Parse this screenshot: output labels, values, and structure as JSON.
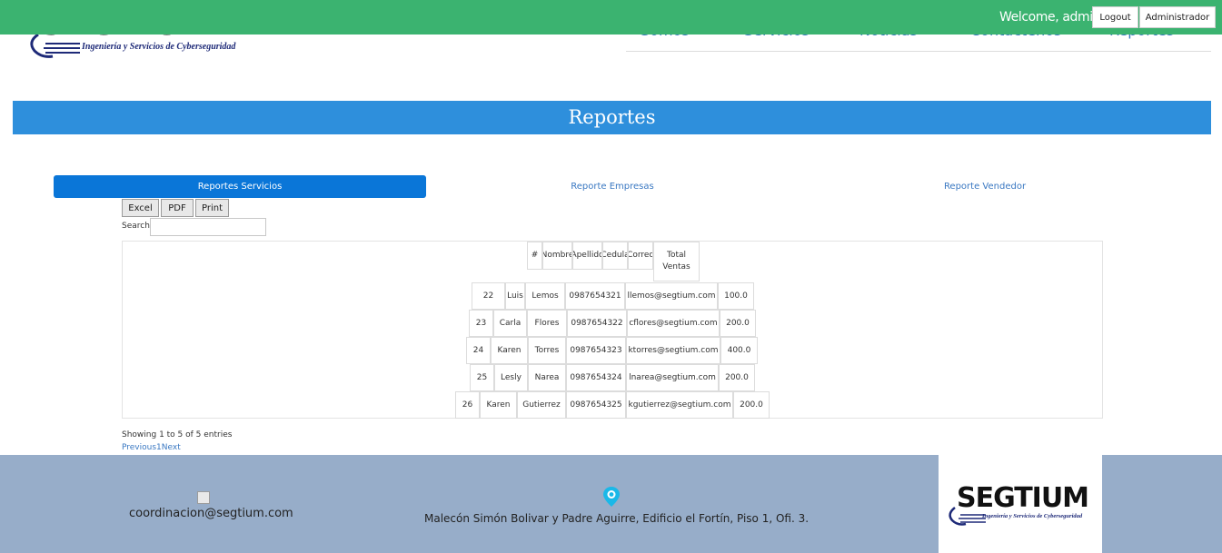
{
  "header": {
    "logo_text": "SEGTIUM",
    "logo_tagline": "Ingeniería y Servicios de Cyberseguridad",
    "nav": [
      "Somos",
      "Servicios",
      "Noticias",
      "Contáctenos",
      "Reportes"
    ],
    "welcome": "Welcome, admin",
    "logout_label": "Logout",
    "admin_label": "Administrador",
    "bar_color": "#3bb370"
  },
  "page": {
    "title": "Reportes",
    "title_color": "#2e8fdc"
  },
  "tabs": [
    {
      "label": "Reportes Servicios",
      "active": true
    },
    {
      "label": "Reporte Empresas",
      "active": false
    },
    {
      "label": "Reporte Vendedor",
      "active": false
    }
  ],
  "datatable": {
    "buttons": [
      "Excel",
      "PDF",
      "Print"
    ],
    "search_label": "Search:",
    "search_value": "",
    "columns": [
      "#",
      "Nombre",
      "Apellido",
      "Cedula",
      "Correo",
      "Total Ventas"
    ],
    "rows": [
      [
        "22",
        "Luis",
        "Lemos",
        "0987654321",
        "llemos@segtium.com",
        "100.0"
      ],
      [
        "23",
        "Carla",
        "Flores",
        "0987654322",
        "cflores@segtium.com",
        "200.0"
      ],
      [
        "24",
        "Karen",
        "Torres",
        "0987654323",
        "ktorres@segtium.com",
        "400.0"
      ],
      [
        "25",
        "Lesly",
        "Narea",
        "0987654324",
        "lnarea@segtium.com",
        "200.0"
      ],
      [
        "26",
        "Karen",
        "Gutierrez",
        "0987654325",
        "kgutierrez@segtium.com",
        "200.0"
      ]
    ],
    "info": "Showing 1 to 5 of 5 entries",
    "pager": {
      "previous": "Previous",
      "page": "1",
      "next": "Next"
    }
  },
  "footer": {
    "email": "coordinacion@segtium.com",
    "address": "Malecón Simón Bolivar y Padre Aguirre, Edificio el Fortín, Piso 1, Ofi. 3.",
    "logo_text": "SEGTIUM",
    "logo_tagline": "Ingeniería y Servicios de Cyberseguridad",
    "bg_color": "#97adc9",
    "pin_color": "#1ab8e8"
  }
}
